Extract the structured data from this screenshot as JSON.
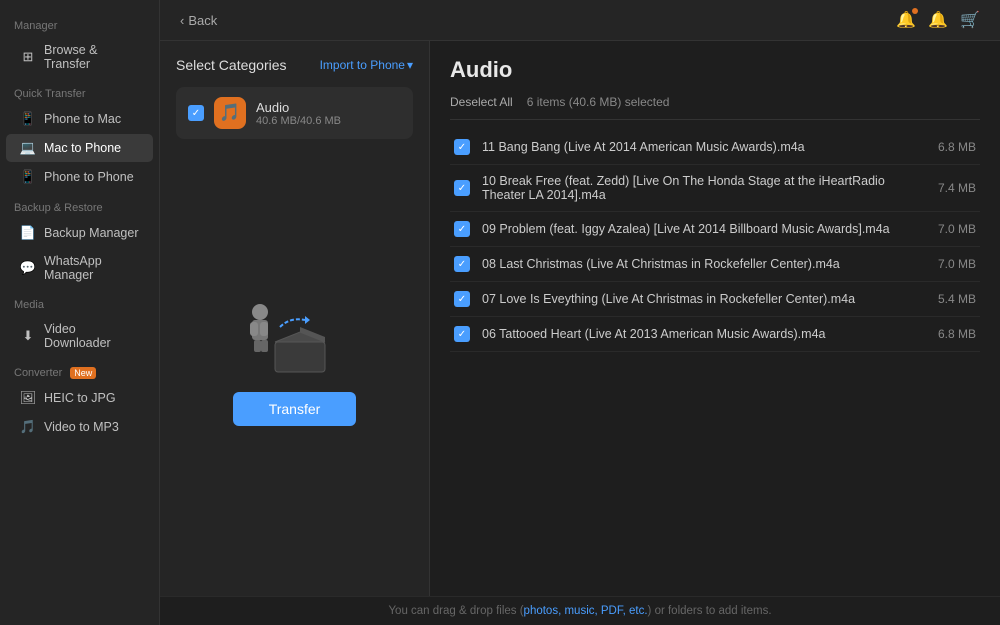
{
  "sidebar": {
    "sections": [
      {
        "label": "Manager",
        "items": [
          {
            "id": "browse-transfer",
            "label": "Browse & Transfer",
            "icon": "⊞",
            "active": false
          }
        ]
      },
      {
        "label": "Quick Transfer",
        "items": [
          {
            "id": "phone-to-mac",
            "label": "Phone to Mac",
            "icon": "📱",
            "active": false
          },
          {
            "id": "mac-to-phone",
            "label": "Mac to Phone",
            "icon": "💻",
            "active": true
          },
          {
            "id": "phone-to-phone",
            "label": "Phone to Phone",
            "icon": "📱",
            "active": false
          }
        ]
      },
      {
        "label": "Backup & Restore",
        "items": [
          {
            "id": "backup-manager",
            "label": "Backup Manager",
            "icon": "📄",
            "active": false
          },
          {
            "id": "whatsapp-manager",
            "label": "WhatsApp Manager",
            "icon": "💬",
            "active": false
          }
        ]
      },
      {
        "label": "Media",
        "items": [
          {
            "id": "video-downloader",
            "label": "Video Downloader",
            "icon": "⬇",
            "active": false
          }
        ]
      },
      {
        "label": "Converter",
        "badge": "New",
        "items": [
          {
            "id": "heic-to-jpg",
            "label": "HEIC to JPG",
            "icon": "🖼",
            "active": false
          },
          {
            "id": "video-to-mp3",
            "label": "Video to MP3",
            "icon": "🎵",
            "active": false
          }
        ]
      }
    ]
  },
  "header": {
    "back_label": "Back"
  },
  "categories": {
    "title": "Select Categories",
    "import_label": "Import to Phone",
    "items": [
      {
        "name": "Audio",
        "size": "40.6 MB/40.6 MB",
        "checked": true,
        "icon": "🎵"
      }
    ]
  },
  "transfer_button": "Transfer",
  "audio": {
    "title": "Audio",
    "deselect_label": "Deselect All",
    "selection_info": "6 items (40.6 MB) selected",
    "tracks": [
      {
        "name": "11 Bang Bang (Live At 2014 American Music Awards).m4a",
        "size": "6.8 MB"
      },
      {
        "name": "10 Break Free (feat. Zedd) [Live On The Honda Stage at the iHeartRadio Theater LA 2014].m4a",
        "size": "7.4 MB"
      },
      {
        "name": "09 Problem (feat. Iggy Azalea)  [Live At 2014 Billboard Music Awards].m4a",
        "size": "7.0 MB"
      },
      {
        "name": "08 Last Christmas  (Live At Christmas in Rockefeller Center).m4a",
        "size": "7.0 MB"
      },
      {
        "name": "07 Love Is Eveything (Live At Christmas in Rockefeller Center).m4a",
        "size": "5.4 MB"
      },
      {
        "name": "06 Tattooed Heart  (Live At 2013 American Music Awards).m4a",
        "size": "6.8 MB"
      }
    ]
  },
  "footer": {
    "text_before": "You can drag & drop files (",
    "link_text": "photos, music, PDF, etc.",
    "text_after": ") or folders to add items."
  }
}
